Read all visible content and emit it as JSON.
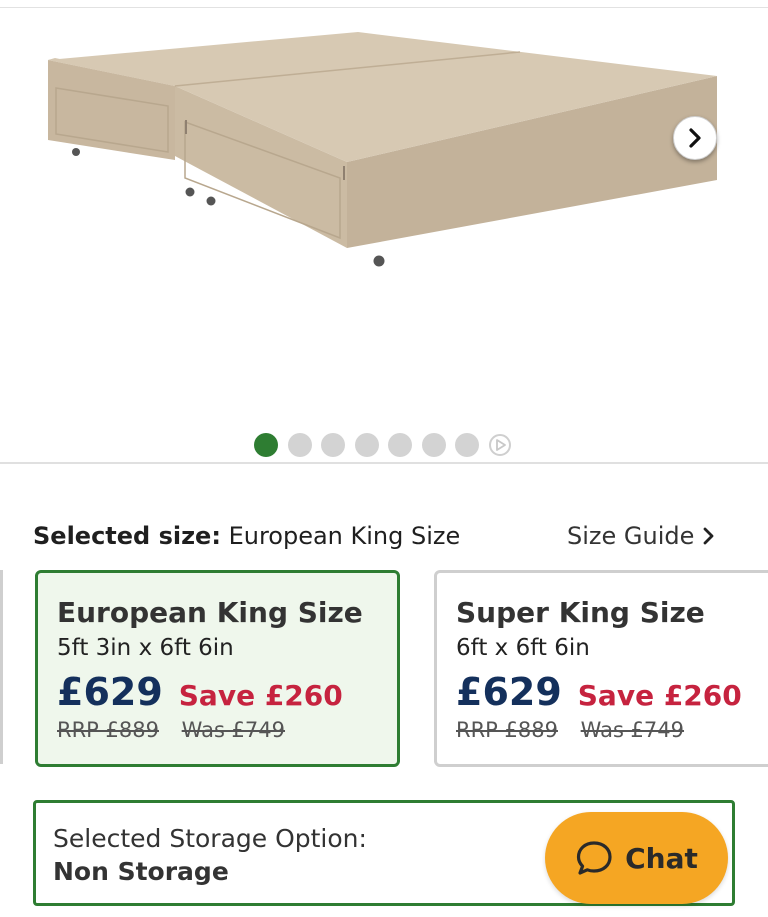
{
  "gallery": {
    "image_alt": "Divan bed base",
    "slide_count": 8,
    "active_slide": 1,
    "next_icon": "chevron-right-icon",
    "last_dot_icon": "play-icon"
  },
  "selection": {
    "label": "Selected size:",
    "value": "European King Size",
    "size_guide": "Size Guide"
  },
  "sizes": [
    {
      "title": "European King Size",
      "dimensions": "5ft 3in x 6ft 6in",
      "price": "£629",
      "save": "Save £260",
      "rrp": "RRP £889",
      "was": "Was £749",
      "selected": true
    },
    {
      "title": "Super King Size",
      "dimensions": "6ft x 6ft 6in",
      "price": "£629",
      "save": "Save £260",
      "rrp": "RRP £889",
      "was": "Was £749",
      "selected": false
    }
  ],
  "storage": {
    "label": "Selected Storage Option:",
    "value": "Non Storage"
  },
  "chat": {
    "label": "Chat",
    "icon": "chat-bubble-icon"
  },
  "colors": {
    "accent_green": "#2e7d32",
    "price_navy": "#14305c",
    "save_red": "#c6233f",
    "chat_orange": "#f5a623"
  }
}
